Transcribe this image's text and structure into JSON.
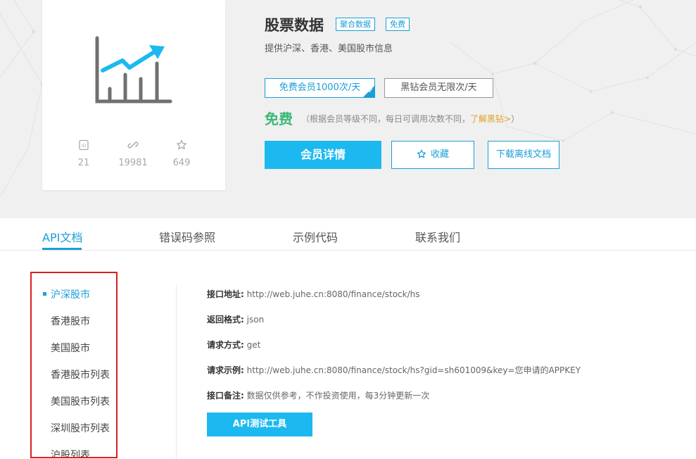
{
  "product": {
    "title": "股票数据",
    "tags": [
      "聚合数据",
      "免费"
    ],
    "subtitle": "提供沪深、香港、美国股市信息",
    "stats": {
      "id": "21",
      "links": "19981",
      "favorites": "649"
    },
    "icons": {
      "logo": "stock-chart-icon",
      "id": "id-card-icon",
      "links": "link-icon",
      "favorites": "star-icon"
    }
  },
  "plans": {
    "free": "免费会员1000次/天",
    "vip": "黑钻会员无限次/天"
  },
  "price": {
    "label": "免费",
    "note": "（根据会员等级不同，每日可调用次数不同，",
    "link": "了解黑钻>",
    "note_end": "）"
  },
  "actions": {
    "detail": "会员详情",
    "favorite": "收藏",
    "download": "下载离线文档"
  },
  "tabs": [
    "API文档",
    "错误码参照",
    "示例代码",
    "联系我们"
  ],
  "sidebar": {
    "items": [
      "沪深股市",
      "香港股市",
      "美国股市",
      "香港股市列表",
      "美国股市列表",
      "深圳股市列表",
      "沪股列表"
    ]
  },
  "details": {
    "url_label": "接口地址:",
    "url": "http://web.juhe.cn:8080/finance/stock/hs",
    "format_label": "返回格式:",
    "format": "json",
    "method_label": "请求方式:",
    "method": "get",
    "example_label": "请求示例:",
    "example": "http://web.juhe.cn:8080/finance/stock/hs?gid=sh601009&key=您申请的APPKEY",
    "note_label": "接口备注:",
    "note": "数据仅供参考，不作投资使用，每3分钟更新一次"
  },
  "api_tool_button": "API测试工具",
  "colors": {
    "accent": "#1a9ed9",
    "button": "#1cb9f0",
    "price": "#3cb878",
    "highlight_border": "#d92020"
  }
}
